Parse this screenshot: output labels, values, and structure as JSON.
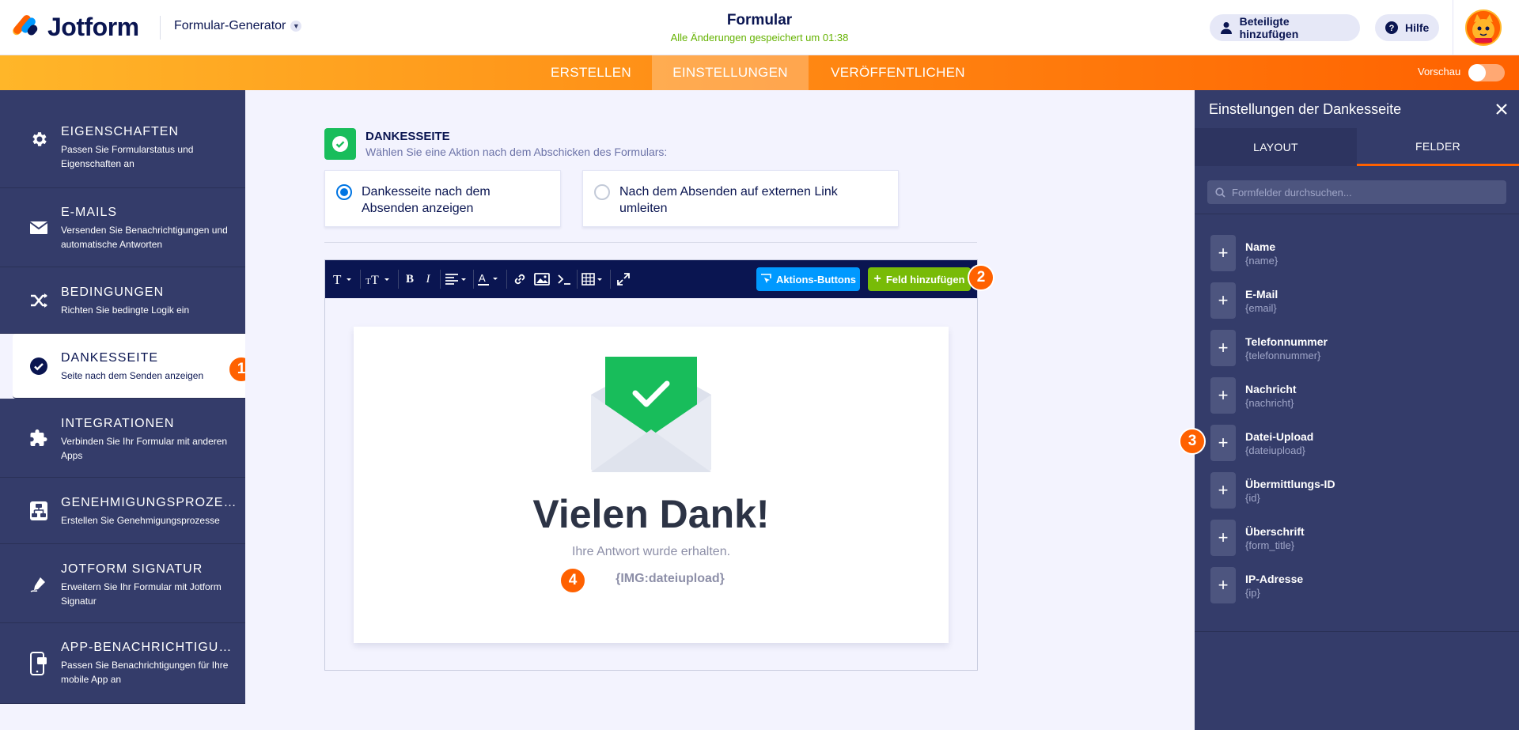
{
  "header": {
    "logo_text": "Jotform",
    "builder_select": "Formular-Generator",
    "form_title": "Formular",
    "save_status": "Alle Änderungen gespeichert um 01:38",
    "add_participants": "Beteiligte hinzufügen",
    "help": "Hilfe"
  },
  "nav": {
    "tabs": [
      "ERSTELLEN",
      "EINSTELLUNGEN",
      "VERÖFFENTLICHEN"
    ],
    "active_tab": "EINSTELLUNGEN",
    "preview_label": "Vorschau",
    "preview_on": false
  },
  "sidebar": {
    "items": [
      {
        "title": "EIGENSCHAFTEN",
        "desc": "Passen Sie Formularstatus und Eigenschaften an",
        "icon": "gear-icon"
      },
      {
        "title": "E-MAILS",
        "desc": "Versenden Sie Benachrichtigungen und automatische Antworten",
        "icon": "envelope-icon"
      },
      {
        "title": "BEDINGUNGEN",
        "desc": "Richten Sie bedingte Logik ein",
        "icon": "shuffle-icon"
      },
      {
        "title": "DANKESSEITE",
        "desc": "Seite nach dem Senden anzeigen",
        "icon": "check-circle-icon"
      },
      {
        "title": "INTEGRATIONEN",
        "desc": "Verbinden Sie Ihr Formular mit anderen Apps",
        "icon": "puzzle-icon"
      },
      {
        "title": "GENEHMIGUNGSPROZES...",
        "desc": "Erstellen Sie Genehmigungsprozesse",
        "icon": "workflow-icon"
      },
      {
        "title": "JOTFORM SIGNATUR",
        "desc": "Erweitern Sie Ihr Formular mit Jotform Signatur",
        "icon": "pen-icon"
      },
      {
        "title": "APP-BENACHRICHTIGUNG",
        "desc": "Passen Sie Benachrichtigungen für Ihre mobile App an",
        "icon": "mobile-icon"
      }
    ],
    "active_index": 3
  },
  "badges": [
    "1",
    "2",
    "3",
    "4"
  ],
  "main": {
    "section_title": "DANKESSEITE",
    "section_desc": "Wählen Sie eine Aktion nach dem Abschicken des Formulars:",
    "option_show": "Dankesseite nach dem Absenden anzeigen",
    "option_redirect": "Nach dem Absenden auf externen Link umleiten",
    "selected_option": "show"
  },
  "editor": {
    "actions_button": "Aktions-Buttons",
    "add_field_button": "Feld hinzufügen",
    "thanks_title": "Vielen Dank!",
    "thanks_sub": "Ihre Antwort wurde erhalten.",
    "img_token": "{IMG:dateiupload}"
  },
  "right_panel": {
    "title": "Einstellungen der Dankesseite",
    "tabs": [
      "LAYOUT",
      "FELDER"
    ],
    "active_tab": "FELDER",
    "search_placeholder": "Formfelder durchsuchen...",
    "fields": [
      {
        "name": "Name",
        "token": "{name}"
      },
      {
        "name": "E-Mail",
        "token": "{email}"
      },
      {
        "name": "Telefonnummer",
        "token": "{telefonnummer}"
      },
      {
        "name": "Nachricht",
        "token": "{nachricht}"
      },
      {
        "name": "Datei-Upload",
        "token": "{dateiupload}"
      },
      {
        "name": "Übermittlungs-ID",
        "token": "{id}"
      },
      {
        "name": "Überschrift",
        "token": "{form_title}"
      },
      {
        "name": "IP-Adresse",
        "token": "{ip}"
      }
    ]
  },
  "colors": {
    "brand_orange": "#ff6100",
    "navy": "#0a1551",
    "sidebar": "#343c6a",
    "success_green": "#18bd5b",
    "save_green": "#64b200",
    "blue_button": "#0099ff",
    "green_button": "#78bb07"
  }
}
